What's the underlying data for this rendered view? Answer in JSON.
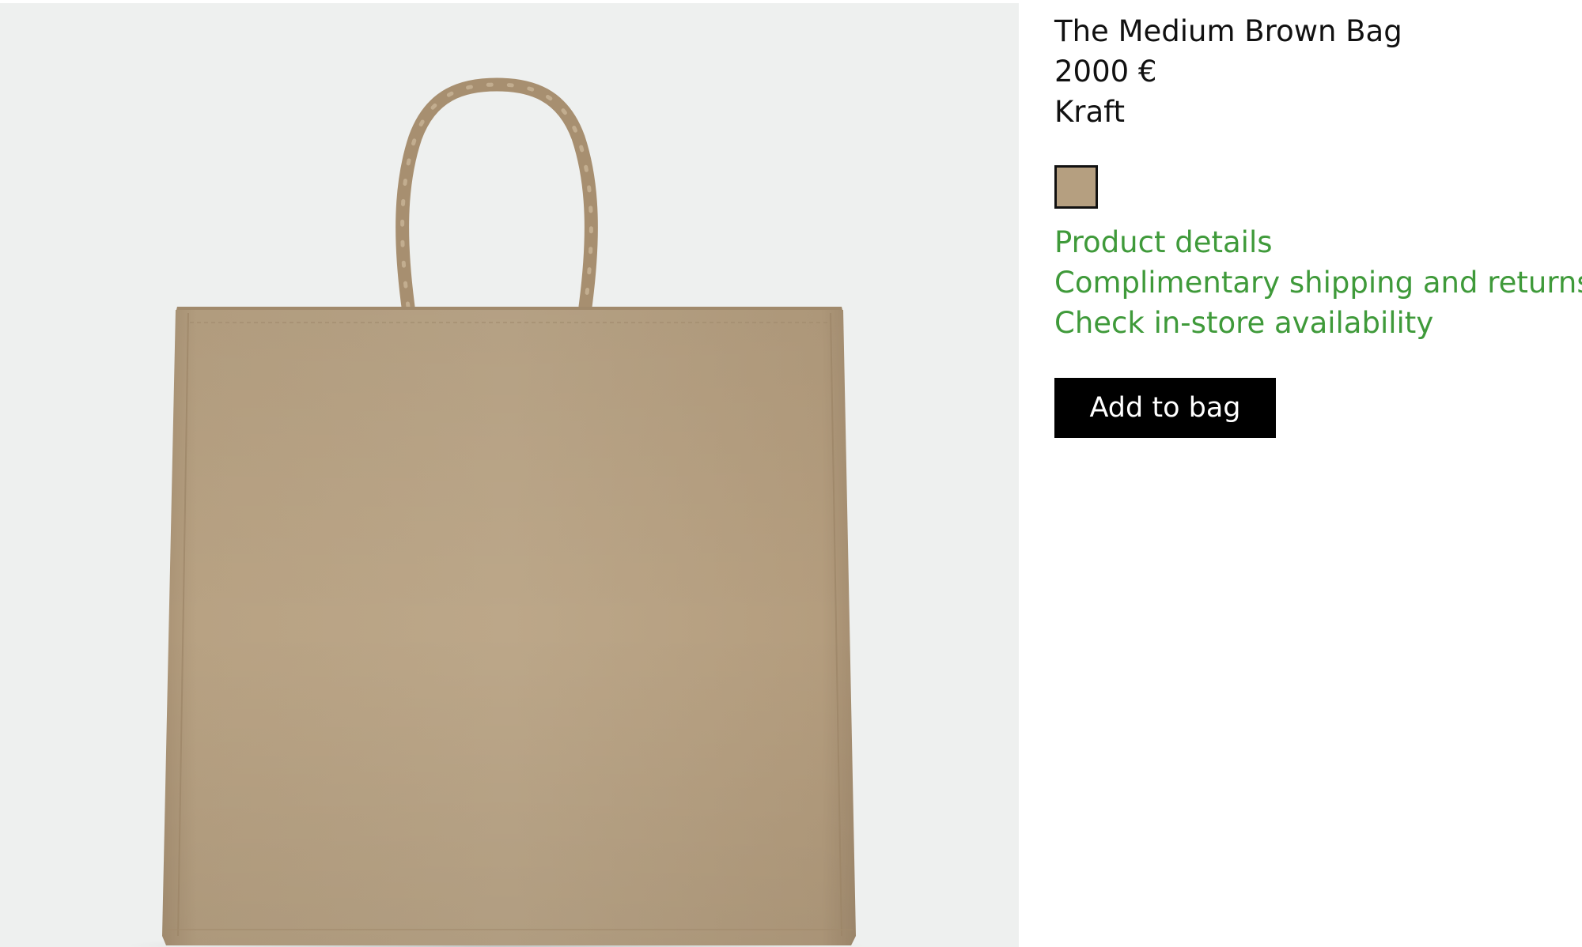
{
  "product": {
    "name": "The Medium Brown Bag",
    "price": "2000 €",
    "color_name": "Kraft",
    "swatch_color": "#b59f80",
    "image_description_icon": "product-image"
  },
  "links": [
    {
      "label": "Product details"
    },
    {
      "label": "Complimentary shipping and returns"
    },
    {
      "label": "Check in-store availability"
    }
  ],
  "actions": {
    "add_to_bag_label": "Add to bag"
  },
  "colors": {
    "link_green": "#3f9a3a",
    "bag_tan": "#b8a283",
    "image_background": "#eef0ef",
    "button_black": "#000000"
  }
}
